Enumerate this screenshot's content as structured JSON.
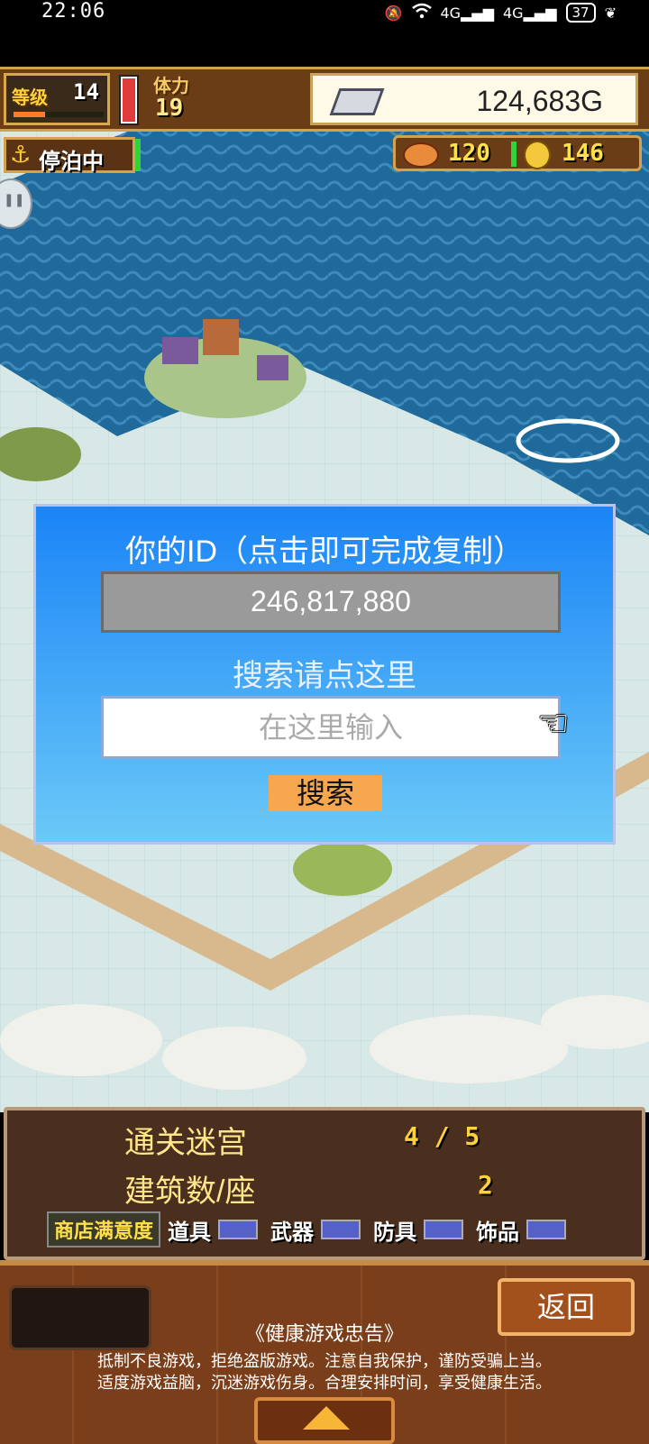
{
  "status_bar": {
    "time": "22:06",
    "battery": "37",
    "network": "4G"
  },
  "hud": {
    "level_label": "等级",
    "level": "14",
    "level_progress": 0.35,
    "stamina_label": "体力",
    "stamina": "19",
    "stamina_level": 1.0,
    "gold": "124,683G",
    "dock_status": "停泊中",
    "food": "120",
    "coins": "146"
  },
  "dialog": {
    "title": "你的ID（点击即可完成复制）",
    "id_value": "246,817,880",
    "search_hint": "搜索请点这里",
    "input_placeholder": "在这里输入",
    "search_button": "搜索"
  },
  "info": {
    "dungeon_label": "通关迷宫",
    "dungeon_value": "4 / 5",
    "buildings_label": "建筑数/座",
    "buildings_value": "2",
    "satisfaction_label": "商店满意度",
    "categories": [
      "道具",
      "武器",
      "防具",
      "饰品"
    ]
  },
  "footer": {
    "back_button": "返回",
    "notice_title": "《健康游戏忠告》",
    "notice_line1": "抵制不良游戏，拒绝盗版游戏。注意自我保护，谨防受骗上当。",
    "notice_line2": "适度游戏益脑，沉迷游戏伤身。合理安排时间，享受健康生活。"
  },
  "colors": {
    "sea": "#1f6a9a",
    "dialog_top": "#1a84f7",
    "dialog_bottom": "#6bc9f7",
    "accent_button": "#f7a84e"
  }
}
